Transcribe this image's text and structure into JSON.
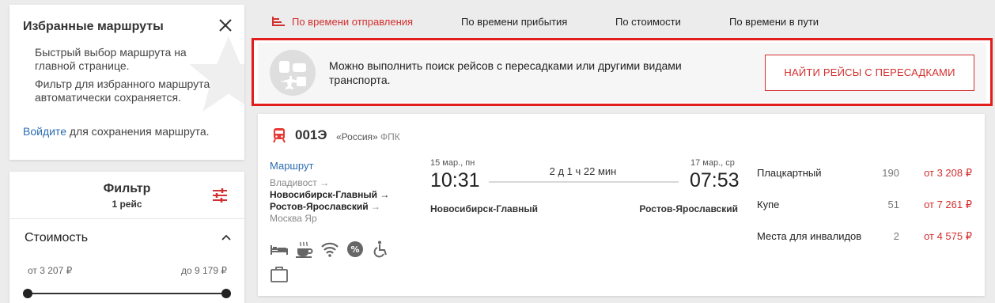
{
  "favorites": {
    "title": "Избранные маршруты",
    "text1": "Быстрый выбор маршрута на главной странице.",
    "text2": "Фильтр для избранного маршрута автоматически сохраняется.",
    "login_link": "Войдите",
    "login_rest": " для сохранения маршрута."
  },
  "filter": {
    "title": "Фильтр",
    "count": "1 рейс",
    "cost_title": "Стоимость",
    "range_from": "от 3 207 ₽",
    "range_to": "до 9 179 ₽"
  },
  "sort": {
    "items": [
      {
        "label": "По времени отправления",
        "active": true
      },
      {
        "label": "По времени прибытия",
        "active": false
      },
      {
        "label": "По стоимости",
        "active": false
      },
      {
        "label": "По времени в пути",
        "active": false
      }
    ]
  },
  "banner": {
    "text": "Можно выполнить поиск рейсов с пересадками или другими видами транспорта.",
    "button": "НАЙТИ РЕЙСЫ С ПЕРЕСАДКАМИ"
  },
  "train": {
    "number": "001Э",
    "brand": "«Россия»",
    "carrier": "ФПК",
    "route_link": "Маршрут",
    "route": {
      "origin": "Владивост →",
      "from": "Новосибирск-Главный →",
      "to": "Ростов-Ярославский",
      "to_arrow": " →",
      "dest": "Москва Яр"
    },
    "departure": {
      "date": "15 мар., пн",
      "time": "10:31",
      "station": "Новосибирск-Главный"
    },
    "arrival": {
      "date": "17 мар., ср",
      "time": "07:53",
      "station": "Ростов-Ярославский"
    },
    "duration": "2 д 1 ч 22 мин",
    "amenities": [
      "bed-icon",
      "coffee-icon",
      "wifi-icon",
      "discount-icon",
      "wheelchair-icon",
      "luggage-icon"
    ],
    "seats": [
      {
        "type": "Плацкартный",
        "count": "190",
        "price": "от 3 208 ₽"
      },
      {
        "type": "Купе",
        "count": "51",
        "price": "от 7 261 ₽"
      },
      {
        "type": "Места для инвалидов",
        "count": "2",
        "price": "от 4 575 ₽"
      }
    ]
  },
  "colors": {
    "accent": "#d32f2f",
    "link": "#2b6cb0",
    "highlight_border": "#e11d1d"
  }
}
